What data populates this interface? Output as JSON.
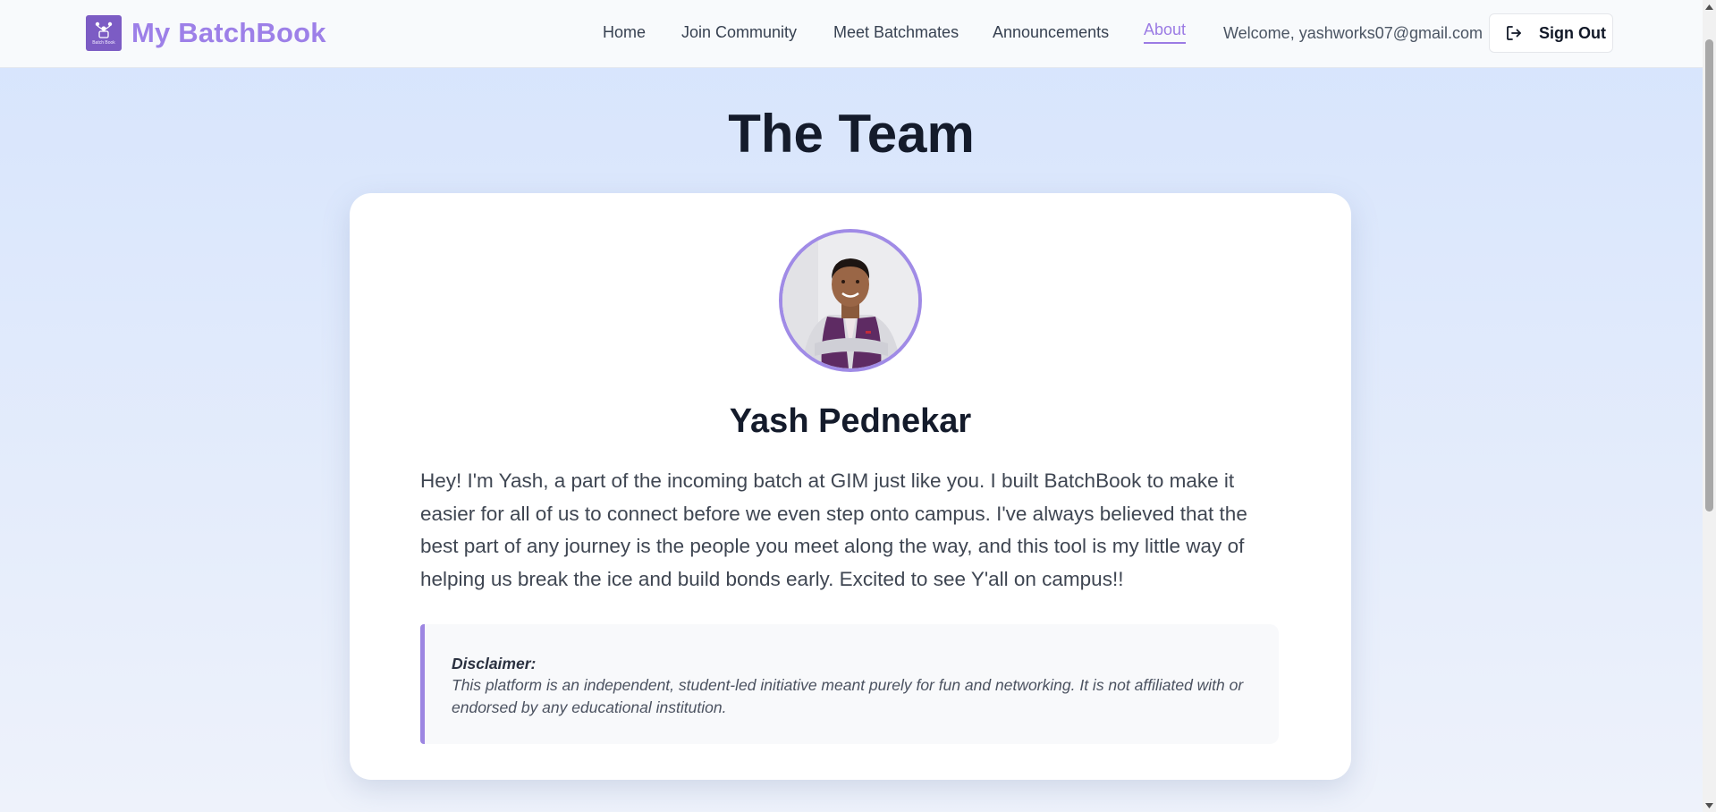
{
  "header": {
    "brand": "My BatchBook",
    "logo_caption": "Batch Book",
    "nav": [
      {
        "label": "Home",
        "active": false
      },
      {
        "label": "Join Community",
        "active": false
      },
      {
        "label": "Meet Batchmates",
        "active": false
      },
      {
        "label": "Announcements",
        "active": false
      },
      {
        "label": "About",
        "active": true
      }
    ],
    "welcome": "Welcome, yashworks07@gmail.com",
    "sign_out_label": "Sign Out",
    "sign_out_icon": "sign-out-icon"
  },
  "page": {
    "title": "The Team"
  },
  "member": {
    "name": "Yash Pednekar",
    "avatar_icon": "profile-photo",
    "bio": "Hey! I'm Yash, a part of the incoming batch at GIM just like you. I built BatchBook to make it easier for all of us to connect before we even step onto campus. I've always believed that the best part of any journey is the people you meet along the way, and this tool is my little way of helping us break the ice and build bonds early. Excited to see Y'all on campus!!"
  },
  "disclaimer": {
    "title": "Disclaimer:",
    "text": "This platform is an independent, student-led initiative meant purely for fun and networking. It is not affiliated with or endorsed by any educational institution."
  },
  "colors": {
    "brand": "#9d80e8",
    "accent": "#9b7be4",
    "logo_bg": "#7c5cc4",
    "title": "#141b2b"
  }
}
